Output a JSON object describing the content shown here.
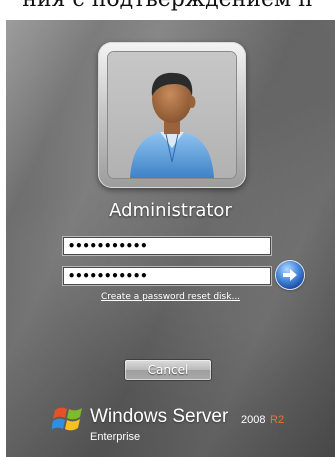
{
  "caption": {
    "text": "ния с подтверждением п"
  },
  "login": {
    "username": "Administrator",
    "password1": "•••••••••••",
    "password2": "•••••••••••",
    "reset_link": "Create a password reset disk...",
    "cancel_label": "Cancel",
    "go_icon": "arrow-right-icon",
    "avatar_icon": "user-avatar-icon"
  },
  "brand": {
    "product": "Windows Server",
    "version": "2008",
    "release": "R2",
    "edition": "Enterprise",
    "logo_icon": "windows-flag-icon"
  },
  "colors": {
    "release_accent": "#e8743a",
    "go_button": "#2f6fc6"
  }
}
